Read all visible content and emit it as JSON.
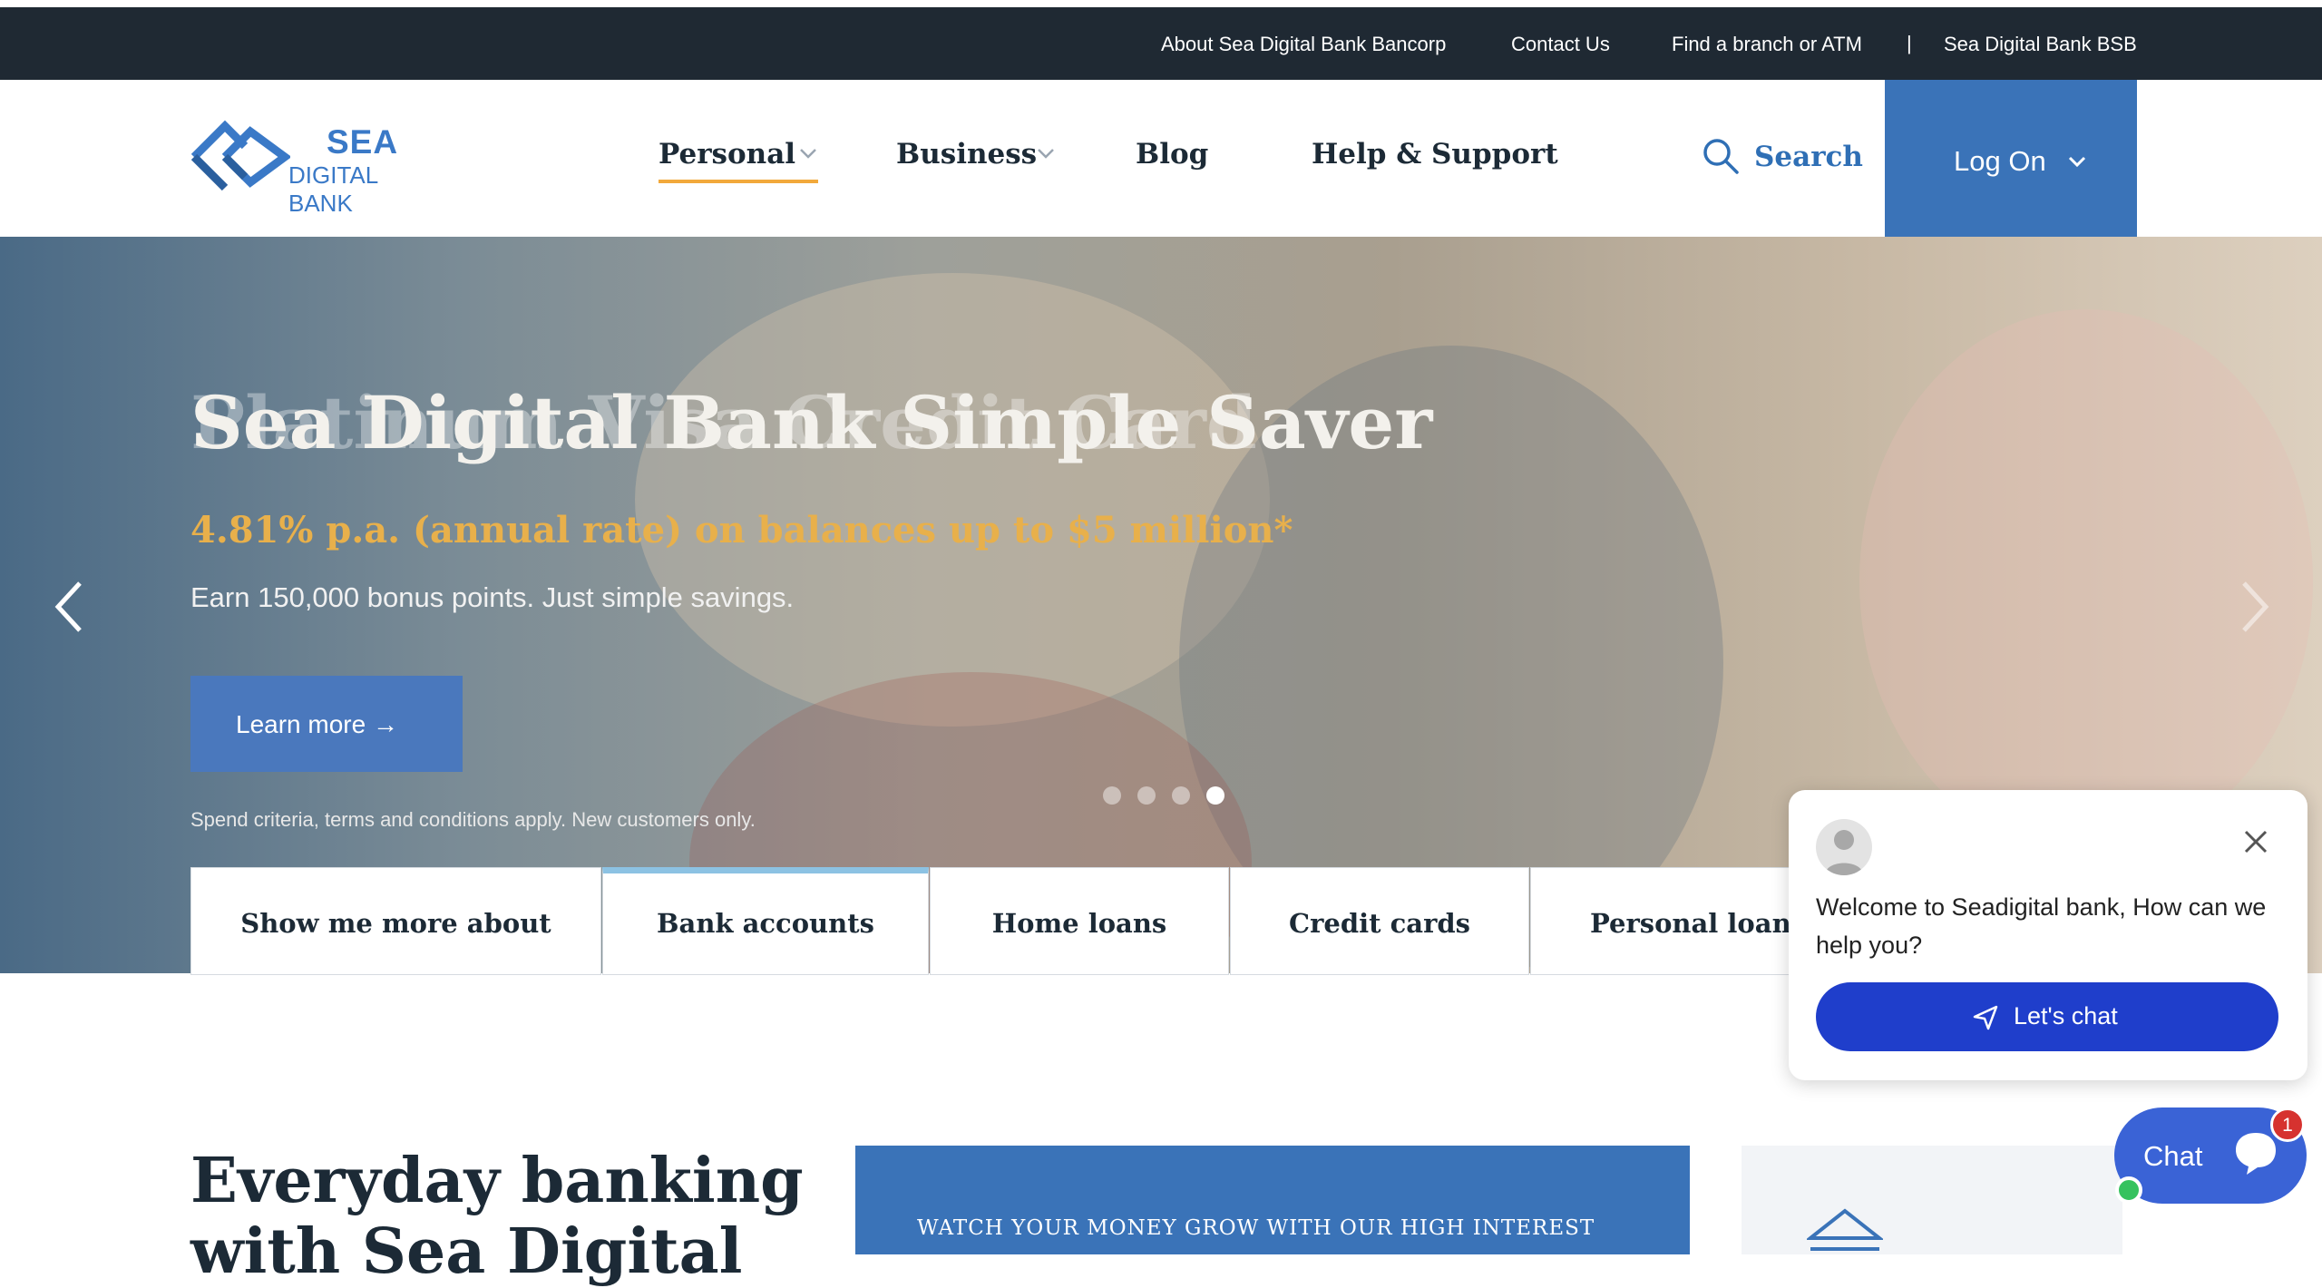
{
  "topbar": {
    "links": [
      "About Sea Digital Bank Bancorp",
      "Contact Us",
      "Find a branch or ATM"
    ],
    "separator": "|",
    "bsb": "Sea Digital Bank BSB"
  },
  "brand": {
    "name_top": "SEA",
    "name_bottom": "DIGITAL BANK",
    "color": "#3a79c7"
  },
  "nav": {
    "items": [
      "Personal",
      "Business",
      "Blog",
      "Help & Support"
    ],
    "active": "Personal",
    "search_label": "Search",
    "logon_label": "Log On"
  },
  "hero": {
    "title": "Sea Digital Bank Simple Saver",
    "title_ghost": "Platinum Visa Credit Card",
    "subtitle": "4.81% p.a. (annual rate) on balances up to $5 million*",
    "body": "Earn 150,000 bonus points. Just simple savings.",
    "cta_label": "Learn more →",
    "fine_print": "Spend criteria, terms and conditions apply. New customers only.",
    "slides": 4,
    "active_slide": 4
  },
  "tabs": {
    "items": [
      "Show me more about",
      "Bank accounts",
      "Home loans",
      "Credit cards",
      "Personal loans"
    ],
    "active": "Bank accounts"
  },
  "section": {
    "heading_line1": "Everyday banking",
    "heading_line2": "with Sea Digital",
    "promo_text": "WATCH YOUR MONEY GROW WITH OUR HIGH INTEREST"
  },
  "chat": {
    "welcome": "Welcome to Seadigital bank, How can we help you?",
    "button_label": "Let's chat",
    "launcher_label": "Chat",
    "badge_count": "1"
  },
  "colors": {
    "topbar": "#1f2933",
    "primary": "#3a73b8",
    "accent": "#f2a93b",
    "chat_button": "#1f3ecb"
  }
}
